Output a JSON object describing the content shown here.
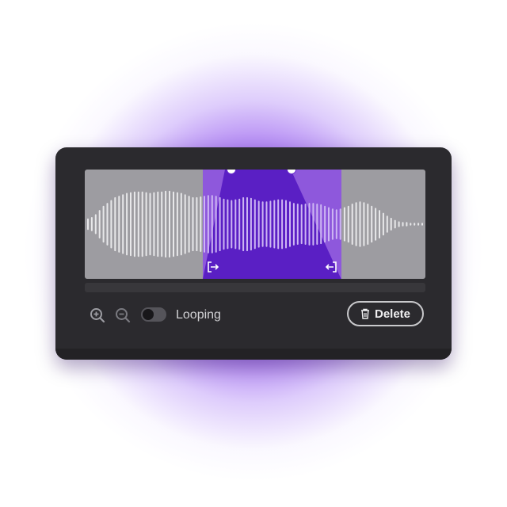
{
  "editor": {
    "waveform": {
      "amplitudes": [
        0.08,
        0.1,
        0.14,
        0.2,
        0.26,
        0.3,
        0.34,
        0.38,
        0.4,
        0.42,
        0.44,
        0.45,
        0.46,
        0.46,
        0.46,
        0.45,
        0.44,
        0.45,
        0.46,
        0.46,
        0.47,
        0.47,
        0.46,
        0.45,
        0.44,
        0.42,
        0.4,
        0.38,
        0.38,
        0.39,
        0.4,
        0.41,
        0.41,
        0.4,
        0.38,
        0.36,
        0.35,
        0.34,
        0.35,
        0.36,
        0.38,
        0.38,
        0.37,
        0.35,
        0.33,
        0.32,
        0.32,
        0.33,
        0.34,
        0.35,
        0.35,
        0.34,
        0.32,
        0.3,
        0.29,
        0.28,
        0.29,
        0.3,
        0.3,
        0.29,
        0.28,
        0.26,
        0.24,
        0.22,
        0.21,
        0.22,
        0.24,
        0.26,
        0.29,
        0.31,
        0.32,
        0.31,
        0.29,
        0.26,
        0.23,
        0.2,
        0.16,
        0.12,
        0.09,
        0.06,
        0.04,
        0.03,
        0.03,
        0.02,
        0.02,
        0.02,
        0.02
      ],
      "selection": {
        "start": 0.347,
        "end": 0.753
      }
    },
    "toolbar": {
      "zoom_in_icon": "zoom-in-icon",
      "zoom_out_icon": "zoom-out-icon",
      "looping_label": "Looping",
      "looping_enabled": false,
      "delete_label": "Delete",
      "delete_icon": "trash-icon"
    },
    "colors": {
      "accent": "#6c2fcf",
      "selection_light": "#8e58dc",
      "selection_dark": "#5a1fc4",
      "waveform_bars": "#e8e8ea",
      "panel": "#2b2a2e",
      "glow": "#7a28e6"
    }
  }
}
